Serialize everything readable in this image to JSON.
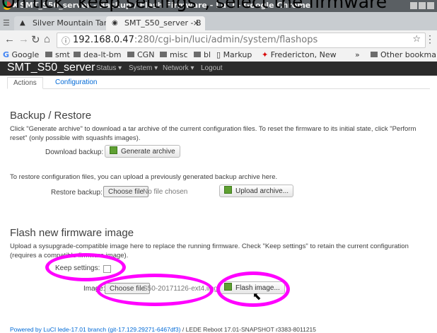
{
  "caption": "On tick \"keep settings\", select the firmware",
  "window": {
    "title": "SMT_S50_server - Backup / Flash Firmware - LuCI - Google Chrome"
  },
  "browser": {
    "tabs": [
      {
        "label": "Silver Mountain Targ",
        "active": false
      },
      {
        "label": "SMT_S50_server - B",
        "active": true
      }
    ],
    "url_host": "192.168.0.47",
    "url_rest": ":280/cgi-bin/luci/admin/system/flashops",
    "bookmarks": [
      "Google",
      "smt",
      "dea-lt-bm",
      "CGN",
      "misc",
      "bl",
      "Markup",
      "Fredericton, New",
      "»",
      "Other bookmarks"
    ]
  },
  "luci": {
    "brand": "SMT_S50_server",
    "menu": [
      "Status ▾",
      "System ▾",
      "Network ▾",
      "Logout"
    ],
    "tabs": [
      "Actions",
      "Configuration"
    ]
  },
  "backup": {
    "title": "Backup / Restore",
    "description": "Click \"Generate archive\" to download a tar archive of the current configuration files. To reset the firmware to its initial state, click \"Perform reset\" (only possible with squashfs images).",
    "download_label": "Download backup:",
    "generate_button": "Generate archive",
    "restore_description": "To restore configuration files, you can upload a previously generated backup archive here.",
    "restore_label": "Restore backup:",
    "choose_file": "Choose file",
    "no_file": "No file chosen",
    "upload_button": "Upload archive..."
  },
  "flash": {
    "title": "Flash new firmware image",
    "description": "Upload a sysupgrade-compatible image here to replace the running firmware. Check \"Keep settings\" to retain the current configuration (requires a compatible firmware image).",
    "keep_label": "Keep settings:",
    "keep_checked": false,
    "image_label": "Image:",
    "choose_file": "Choose file",
    "file_name": "S50-20171126-ext4.img",
    "flash_button": "Flash image..."
  },
  "footer": {
    "link": "Powered by LuCI lede-17.01 branch (git-17.129.29271-6467df3)",
    "rest": " / LEDE Reboot 17.01-SNAPSHOT r3383-8011215"
  },
  "colors": {
    "annotation": "#ff00ff",
    "link": "#0069d6",
    "header_bg": "#2b2b2b"
  }
}
